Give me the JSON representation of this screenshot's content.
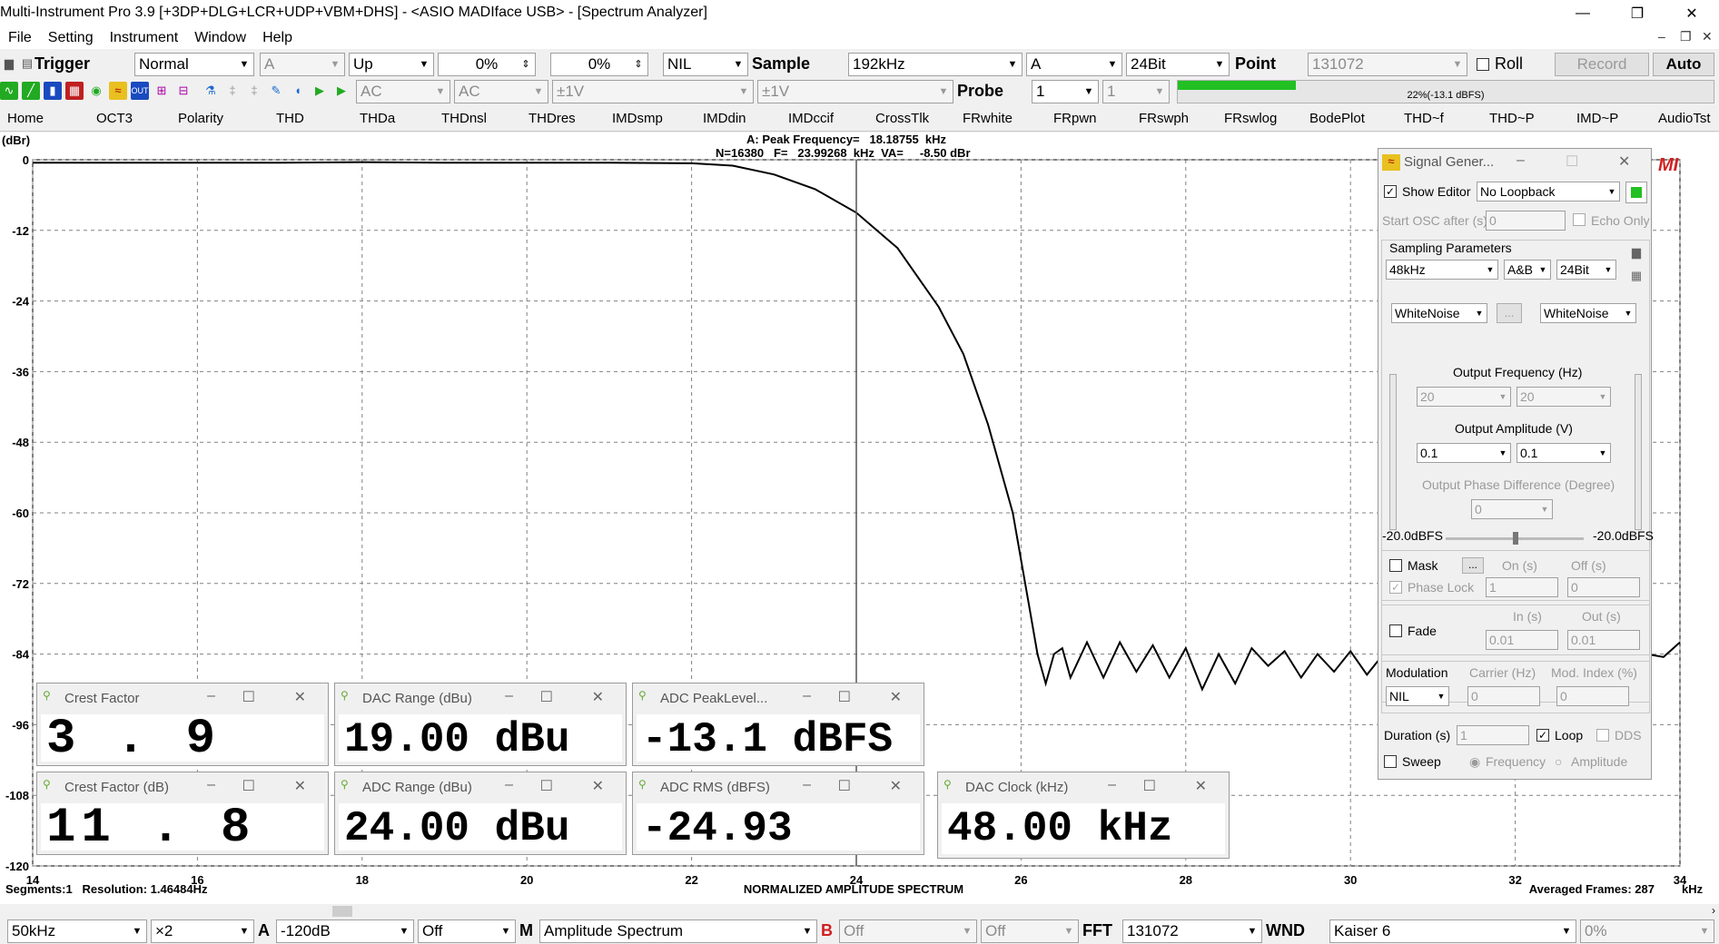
{
  "window": {
    "title": "Multi-Instrument Pro 3.9    [+3DP+DLG+LCR+UDP+VBM+DHS]   -   <ASIO MADIface USB> - [Spectrum Analyzer]",
    "minimize": "—",
    "maximize": "❐",
    "close": "✕"
  },
  "menu": {
    "items": [
      "File",
      "Setting",
      "Instrument",
      "Window",
      "Help"
    ],
    "mdi_min": "–",
    "mdi_restore": "❐",
    "mdi_close": "✕"
  },
  "toolbar1": {
    "trigger_label": "Trigger",
    "trigger_mode": "Normal",
    "trigger_channel": "A",
    "trigger_edge": "Up",
    "trigger_level": "0%",
    "trigger_delay": "0%",
    "nil": "NIL",
    "sample_label": "Sample",
    "sample_rate": "192kHz",
    "channel": "A",
    "bit_depth": "24Bit",
    "point_label": "Point",
    "point_value": "131072",
    "roll_label": "Roll",
    "record_label": "Record",
    "auto_label": "Auto"
  },
  "toolbar2": {
    "coupling_a": "AC",
    "coupling_b": "AC",
    "range_a": "±1V",
    "range_b": "±1V",
    "probe_label": "Probe",
    "probe_a": "1",
    "probe_b": "1",
    "level_text": "22%(-13.1 dBFS)",
    "level_fraction": 0.22
  },
  "tabs": [
    "Home",
    "OCT3",
    "Polarity",
    "THD",
    "THDa",
    "THDnsl",
    "THDres",
    "IMDsmp",
    "IMDdin",
    "IMDccif",
    "CrossTlk",
    "FRwhite",
    "FRpwn",
    "FRswph",
    "FRswlog",
    "BodePlot",
    "THD~f",
    "THD~P",
    "IMD~P",
    "AudioTst"
  ],
  "chart_data": {
    "type": "line",
    "yunit": "(dBr)",
    "xunit": "kHz",
    "xlim": [
      14,
      34
    ],
    "ylim": [
      -120,
      0
    ],
    "xticks": [
      14,
      16,
      18,
      20,
      22,
      24,
      26,
      28,
      30,
      32,
      34
    ],
    "yticks": [
      0,
      -12,
      -24,
      -36,
      -48,
      -60,
      -72,
      -84,
      -96,
      -108,
      -120
    ],
    "grid": true,
    "peak_line1": "A: Peak Frequency=   18.18755  kHz",
    "peak_line2": "N=16380   F=   23.99268  kHz  VA=     -8.50 dBr",
    "footer_left": "Segments:1   Resolution: 1.46484Hz",
    "footer_center": "NORMALIZED AMPLITUDE SPECTRUM",
    "footer_right": "Averaged Frames: 287",
    "brand": "MI",
    "cursor_x": 24,
    "series": [
      {
        "x": [
          14,
          15,
          16,
          17,
          18,
          19,
          20,
          21,
          22,
          22.5,
          23,
          23.5,
          24,
          24.5,
          25,
          25.3,
          25.6,
          25.9,
          26.1,
          26.2,
          26.3,
          26.4,
          26.5,
          26.6,
          26.8,
          27.0,
          27.2,
          27.4,
          27.6,
          27.8,
          28.0,
          28.2,
          28.4,
          28.6,
          28.8,
          29.0,
          29.2,
          29.4,
          29.6,
          29.8,
          30.0,
          30.2,
          30.4,
          30.6,
          30.8,
          31.0,
          31.2,
          31.4,
          31.6,
          31.8,
          32.0,
          32.2,
          32.4,
          32.6,
          32.8,
          33.0,
          33.2,
          33.4,
          33.6,
          33.8,
          34.0
        ],
        "y": [
          -0.5,
          -0.5,
          -0.5,
          -0.5,
          -0.4,
          -0.5,
          -0.5,
          -0.5,
          -0.6,
          -1.0,
          -2.5,
          -5.0,
          -9.0,
          -15.0,
          -25.0,
          -33.0,
          -45.0,
          -60.0,
          -76.0,
          -84.0,
          -89.0,
          -84.0,
          -83.0,
          -88.0,
          -82.0,
          -88.0,
          -82.0,
          -87.0,
          -82.5,
          -88.0,
          -83.0,
          -90.0,
          -84.0,
          -89.0,
          -83.0,
          -86.0,
          -83.5,
          -88.0,
          -84.0,
          -87.0,
          -83.5,
          -87.5,
          -84.0,
          -89.0,
          -83.0,
          -86.5,
          -84.5,
          -88.0,
          -83.5,
          -87.0,
          -84.0,
          -88.5,
          -84.0,
          -87.0,
          -83.0,
          -86.0,
          -84.0,
          -88.0,
          -84.0,
          -84.5,
          -82.0
        ]
      }
    ]
  },
  "panels": [
    {
      "title": "Crest Factor",
      "value": "3 . 9"
    },
    {
      "title": "DAC Range (dBu)",
      "value": "19.00 dBu"
    },
    {
      "title": "ADC PeakLevel...",
      "value": "-13.1 dBFS"
    },
    {
      "title": "Crest Factor (dB)",
      "value": "11 . 8"
    },
    {
      "title": "ADC Range (dBu)",
      "value": "24.00 dBu"
    },
    {
      "title": "ADC RMS (dBFS)",
      "value": "-24.93"
    },
    {
      "title": "DAC Clock (kHz)",
      "value": "48.00 kHz"
    }
  ],
  "panel_buttons": {
    "min": "–",
    "max": "☐",
    "close": "✕"
  },
  "signal_generator": {
    "title": "Signal Gener...",
    "show_editor": "Show Editor",
    "loopback": "No Loopback",
    "start_osc": "Start OSC after (s)",
    "start_osc_value": "0",
    "echo_only": "Echo Only",
    "sampling_params": "Sampling Parameters",
    "rate": "48kHz",
    "channels": "A&B",
    "bits": "24Bit",
    "wave_a": "WhiteNoise",
    "wave_b": "WhiteNoise",
    "ellipsis": "...",
    "out_freq": "Output Frequency (Hz)",
    "freq_a": "20",
    "freq_b": "20",
    "out_amp": "Output Amplitude (V)",
    "amp_a": "0.1",
    "amp_b": "0.1",
    "phase_diff": "Output Phase Difference (Degree)",
    "phase_value": "0",
    "level_a": "-20.0dBFS",
    "level_b": "-20.0dBFS",
    "mask": "Mask",
    "on_s": "On (s)",
    "off_s": "Off (s)",
    "phase_lock": "Phase Lock",
    "on_value": "1",
    "off_value": "0",
    "fade": "Fade",
    "in_s": "In (s)",
    "out_s": "Out (s)",
    "in_value": "0.01",
    "out_value": "0.01",
    "modulation": "Modulation",
    "carrier": "Carrier (Hz)",
    "mod_index": "Mod. Index (%)",
    "mod_type": "NIL",
    "carrier_value": "0",
    "mod_index_value": "0",
    "duration": "Duration (s)",
    "duration_value": "1",
    "loop": "Loop",
    "dds": "DDS",
    "sweep": "Sweep",
    "frequency": "Frequency",
    "amplitude": "Amplitude"
  },
  "bottombar": {
    "freq_range": "50kHz",
    "zoom": "×2",
    "a_label": "A",
    "a_range": "-120dB",
    "a_mode": "Off",
    "m_label": "M",
    "mode": "Amplitude Spectrum",
    "b_label": "B",
    "b_mode1": "Off",
    "b_mode2": "Off",
    "fft_label": "FFT",
    "fft_size": "131072",
    "wnd_label": "WND",
    "window": "Kaiser 6",
    "overlap": "0%"
  },
  "colors": {
    "accent_green": "#22c022",
    "brand_red": "#d02020"
  }
}
